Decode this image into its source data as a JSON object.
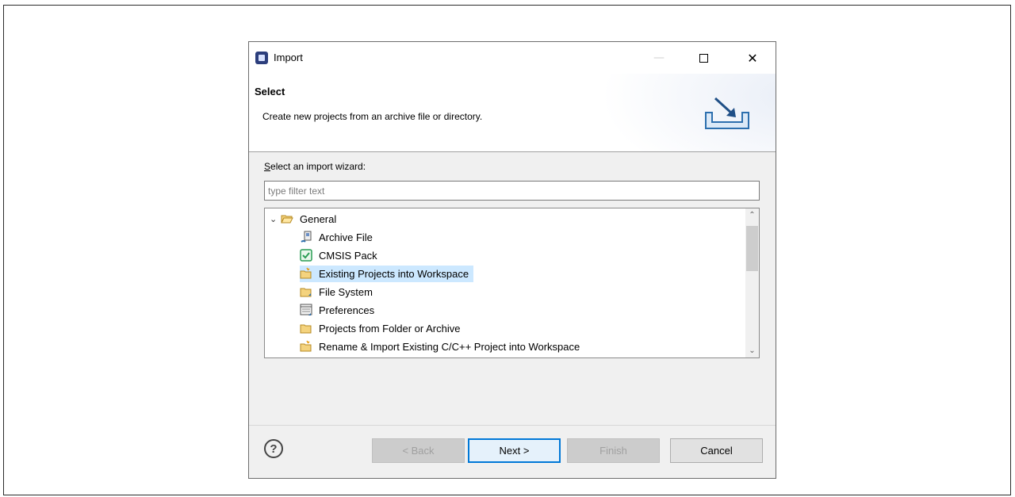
{
  "window": {
    "title": "Import",
    "minimize_glyph": "—",
    "close_glyph": "✕",
    "app_icon": "eclipse-ide-icon"
  },
  "banner": {
    "title": "Select",
    "description": "Create new projects from an archive file or directory.",
    "icon": "import-wizard-icon"
  },
  "wizard": {
    "label": "Select an import wizard:",
    "label_mnemonic": "S",
    "filter_placeholder": "type filter text",
    "filter_value": ""
  },
  "tree": {
    "group": {
      "label": "General",
      "expanded": true,
      "chevron": "⌄",
      "icon": "open-folder-icon"
    },
    "items": [
      {
        "label": "Archive File",
        "icon": "archive-file-icon",
        "selected": false
      },
      {
        "label": "CMSIS Pack",
        "icon": "cmsis-pack-icon",
        "selected": false
      },
      {
        "label": "Existing Projects into Workspace",
        "icon": "existing-projects-icon",
        "selected": true
      },
      {
        "label": "File System",
        "icon": "file-system-icon",
        "selected": false
      },
      {
        "label": "Preferences",
        "icon": "preferences-icon",
        "selected": false
      },
      {
        "label": "Projects from Folder or Archive",
        "icon": "folder-archive-icon",
        "selected": false
      },
      {
        "label": "Rename & Import Existing C/C++ Project into Workspace",
        "icon": "rename-import-icon",
        "selected": false
      }
    ],
    "scroll_up": "⌃",
    "scroll_down": "⌄"
  },
  "footer": {
    "help_glyph": "?",
    "back_label": "< Back",
    "next_label": "Next >",
    "finish_label": "Finish",
    "cancel_label": "Cancel"
  },
  "colors": {
    "selection": "#cce8ff",
    "default_button_border": "#0078d7"
  }
}
